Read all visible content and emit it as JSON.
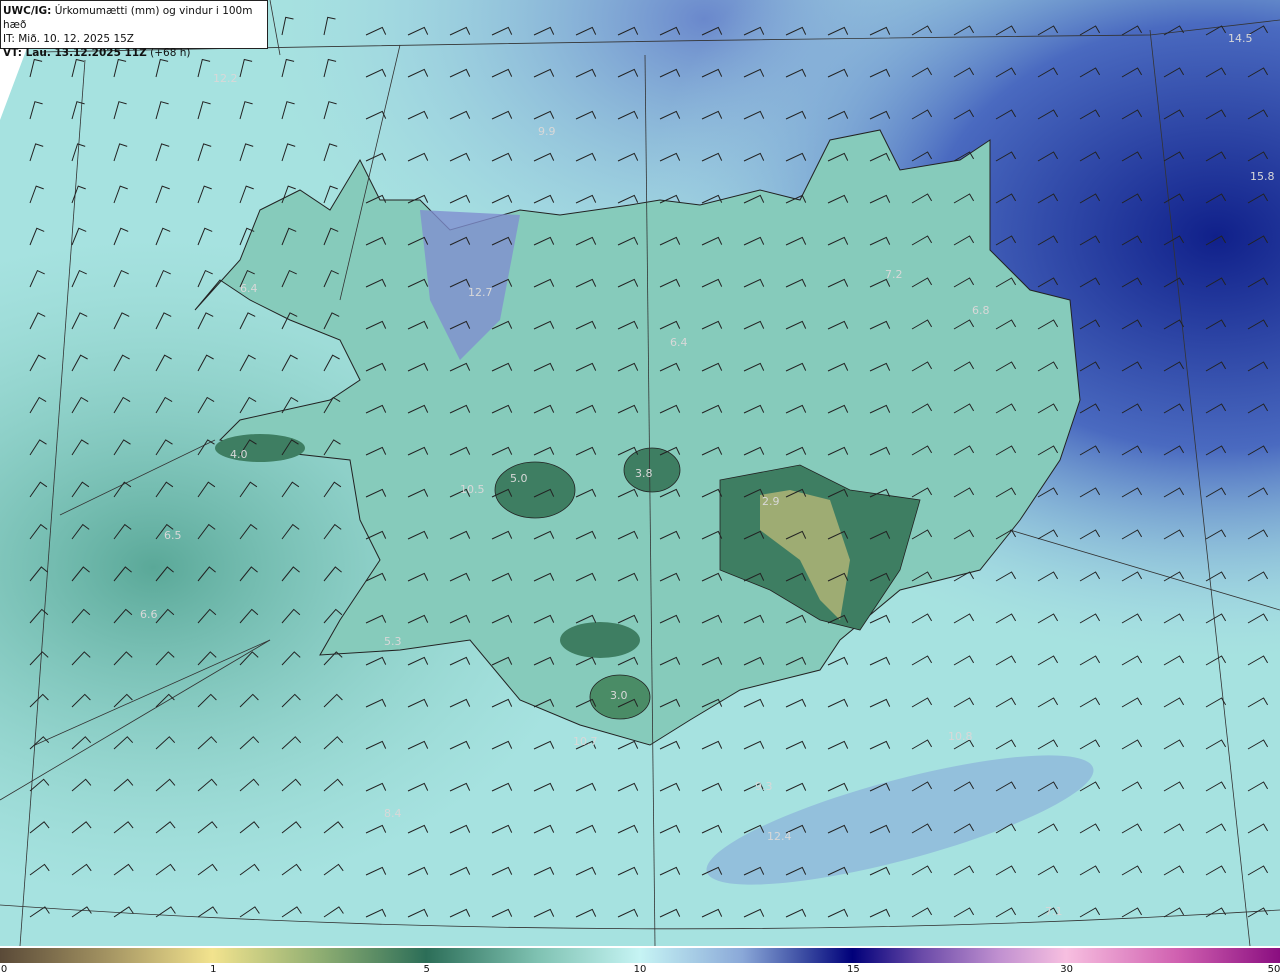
{
  "header": {
    "model": "UWC/IG:",
    "title": "Úrkomumætti (mm) og vindur i 100m hæð",
    "issue_time": "IT: Mið. 10. 12. 2025 15Z",
    "valid_label": "VT: Lau. 13.12.2025 11Z",
    "lead": "(+68 h)"
  },
  "colorbar": {
    "ticks": [
      "0",
      "1",
      "5",
      "10",
      "15",
      "30",
      "50"
    ],
    "colors": [
      "#5a4a38",
      "#f2e38e",
      "#2c6e58",
      "#c6f4f4",
      "#00007a",
      "#f7bfe0",
      "#8a0e80"
    ]
  },
  "map_values": [
    "12.2",
    "14.5",
    "15.8",
    "9.9",
    "6.4",
    "12.7",
    "7.2",
    "6.8",
    "6.4",
    "4.0",
    "5.0",
    "3.8",
    "10.5",
    "2.9",
    "6.5",
    "6.6",
    "5.3",
    "3.0",
    "10.7",
    "10.8",
    "9.3",
    "12.4",
    "8.4",
    "7.1"
  ]
}
